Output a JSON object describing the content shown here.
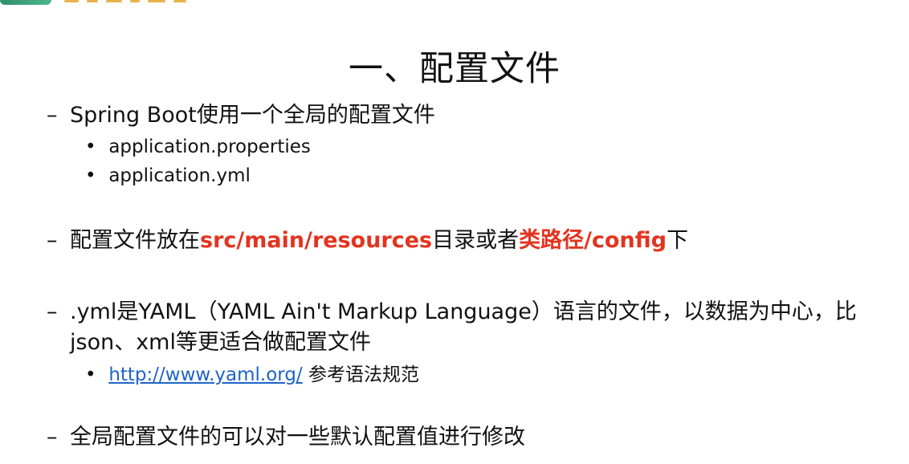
{
  "slide": {
    "title": "一、配置文件",
    "items": [
      {
        "dash": "–",
        "text": "Spring Boot使用一个全局的配置文件",
        "subitems": [
          {
            "bullet": "•",
            "text": "application.properties"
          },
          {
            "bullet": "•",
            "text": "application.yml"
          }
        ]
      },
      {
        "dash": "–",
        "segments": [
          {
            "text": "配置文件放在"
          },
          {
            "text": "src/main/resources"
          },
          {
            "text": "目录或者"
          },
          {
            "text": "类路径/config"
          },
          {
            "text": "下"
          }
        ]
      },
      {
        "dash": "–",
        "text": ".yml是YAML（YAML Ain't Markup Language）语言的文件，以数据为中心，比json、xml等更适合做配置文件",
        "subitems": [
          {
            "bullet": "•",
            "link": "http://www.yaml.org/",
            "text": " 参考语法规范"
          }
        ]
      },
      {
        "dash": "–",
        "text": "全局配置文件的可以对一些默认配置值进行修改"
      }
    ]
  },
  "colors": {
    "emphasis": "#e3341f",
    "link": "#1e64c8",
    "text": "#111111",
    "background": "#ffffff",
    "logo": "#2f8f6d"
  }
}
